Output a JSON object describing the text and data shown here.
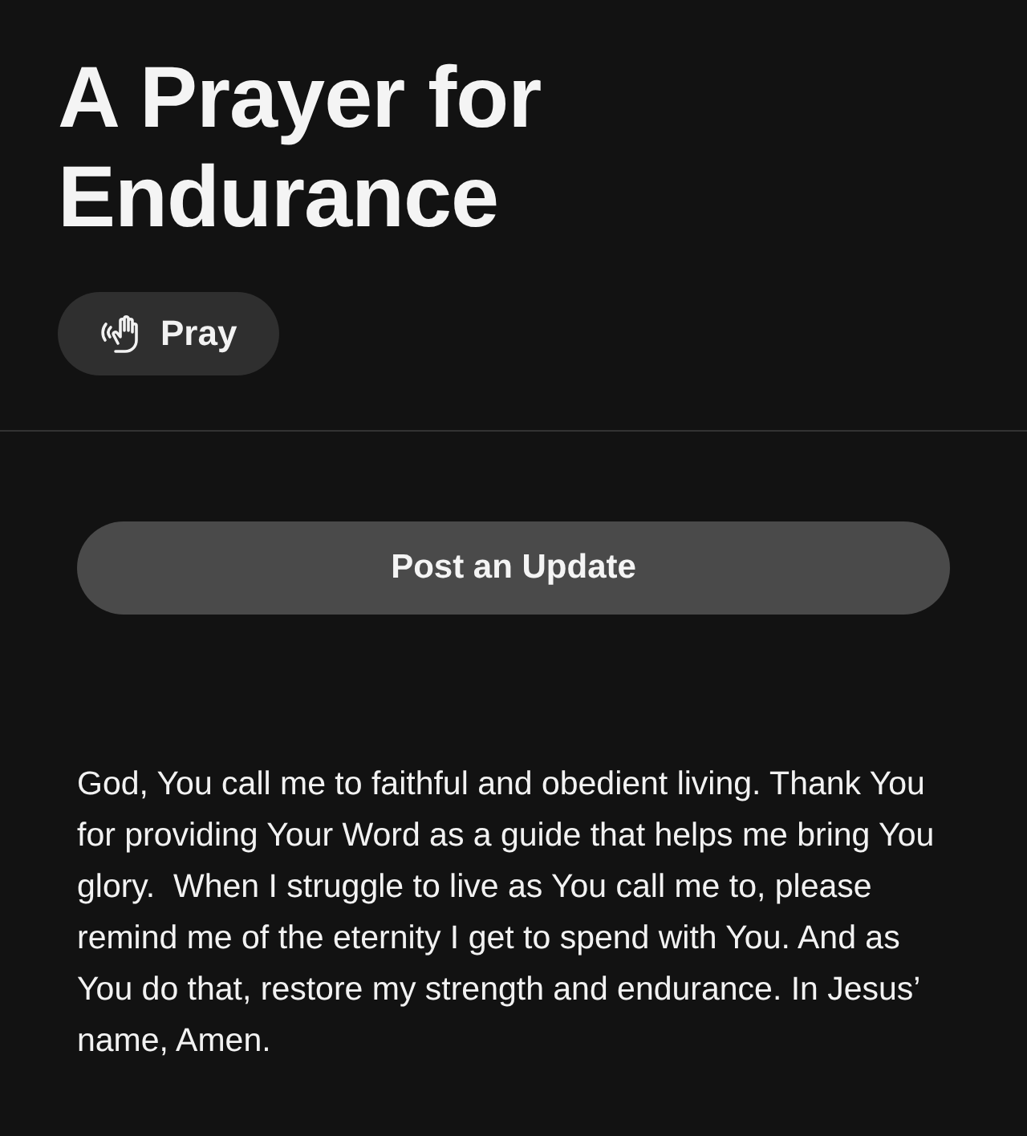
{
  "title": "A Prayer for Endurance",
  "pray_button": {
    "label": "Pray"
  },
  "update_button": {
    "label": "Post an Update"
  },
  "prayer_text": "God, You call me to faithful and obedient living. Thank You for providing Your Word as a guide that helps me bring You glory.  When I struggle to live as You call me to, please remind me of the eternity I get to spend with You. And as You do that, restore my strength and endurance. In Jesus’ name, Amen."
}
